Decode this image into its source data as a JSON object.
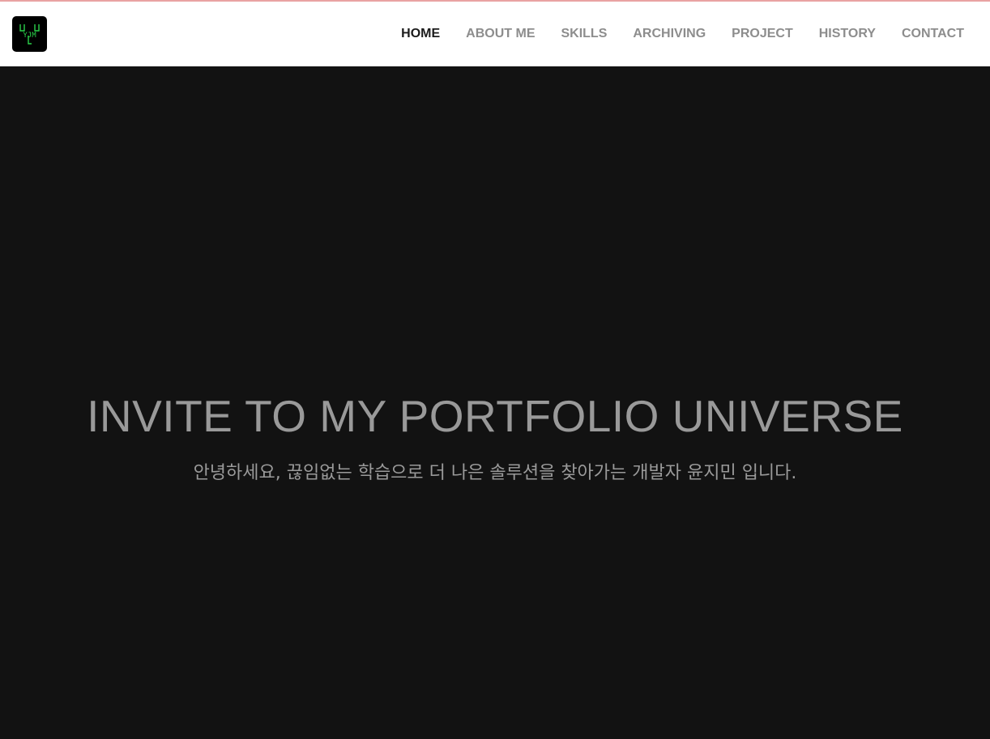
{
  "header": {
    "logo_name": "YJM logo",
    "logo_text": "YJM",
    "nav": [
      {
        "label": "HOME",
        "active": true
      },
      {
        "label": "ABOUT ME",
        "active": false
      },
      {
        "label": "SKILLS",
        "active": false
      },
      {
        "label": "ARCHIVING",
        "active": false
      },
      {
        "label": "PROJECT",
        "active": false
      },
      {
        "label": "HISTORY",
        "active": false
      },
      {
        "label": "CONTACT",
        "active": false
      }
    ]
  },
  "hero": {
    "title": "INVITE TO MY PORTFOLIO UNIVERSE",
    "subtitle": "안녕하세요, 끊임없는 학습으로 더 나은 솔루션을 찾아가는 개발자 윤지민 입니다."
  },
  "colors": {
    "nav_active": "#1b1b1b",
    "nav_inactive": "#8d8d8d",
    "hero_bg": "#121212",
    "hero_text": "#999999",
    "logo_accent": "#2bd14a"
  }
}
